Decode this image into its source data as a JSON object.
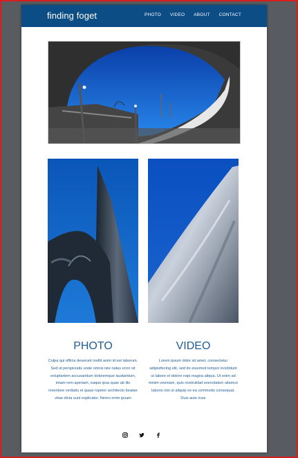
{
  "brand": "finding foget",
  "nav": [
    "PHOTO",
    "VIDEO",
    "ABOUT",
    "CONTACT"
  ],
  "columns": [
    {
      "title": "PHOTO",
      "text": "Culpa qui officia deserunt mollit anim id est laborum. Sed ut perspiciatis unde omnis iste natus error sit voluptartem accusantium doloremque laudantium, totam rem aperiam, eaque ipsa quae ab illo inventore veritatis et quasi ropeior architecto beatae vitae dicta sunt explicabo. Nemo enim ipsam"
    },
    {
      "title": "VIDEO",
      "text": "Lorem ipsum dolor sit amet, consectetur adipisifecing elit, sed do eiusmod tempor incididunt ut labore et dolore roipi magna aliqua. Ut enim ad minim veeniam, quis nostruklad exercitation ullamco laboris nisi ut aliquip ex ea commodo consequat. Duis aute irure"
    }
  ],
  "social": [
    "instagram-icon",
    "twitter-icon",
    "facebook-icon"
  ],
  "colors": {
    "navbar": "#0d4d86",
    "text_accent": "#1f5c96",
    "backdrop": "#585c60",
    "border": "#d81d1d"
  }
}
